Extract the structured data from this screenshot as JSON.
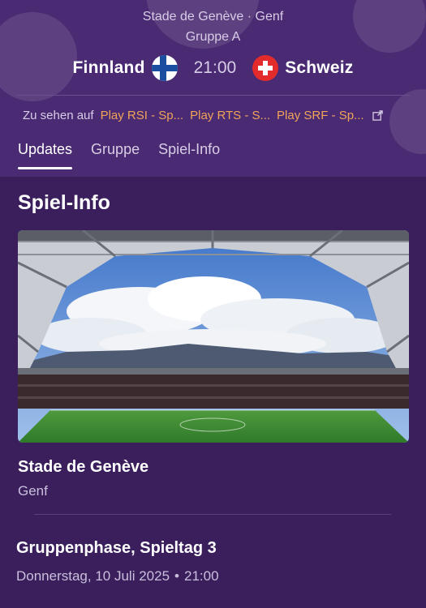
{
  "header": {
    "venue_line": "Stade de Genève · Genf",
    "group_line": "Gruppe A",
    "home_team": "Finnland",
    "away_team": "Schweiz",
    "kickoff": "21:00",
    "home_flag": "finland-flag",
    "away_flag": "switzerland-flag"
  },
  "broadcast": {
    "label": "Zu sehen auf",
    "streams": [
      "Play RSI - Sp...",
      "Play RTS - S...",
      "Play SRF - Sp..."
    ],
    "icon": "external-link-icon",
    "accent": "#f0a45a"
  },
  "tabs": [
    {
      "label": "Updates",
      "active": true
    },
    {
      "label": "Gruppe",
      "active": false
    },
    {
      "label": "Spiel-Info",
      "active": false
    }
  ],
  "info": {
    "title": "Spiel-Info",
    "stadium_name": "Stade de Genève",
    "stadium_city": "Genf",
    "stage": "Gruppenphase, Spieltag 3",
    "date": "Donnerstag, 10 Juli 2025",
    "separator": "•",
    "time": "21:00"
  },
  "colors": {
    "background": "#3a1f5c",
    "header": "#4a2a72",
    "pitch": "#3f8f3a"
  }
}
